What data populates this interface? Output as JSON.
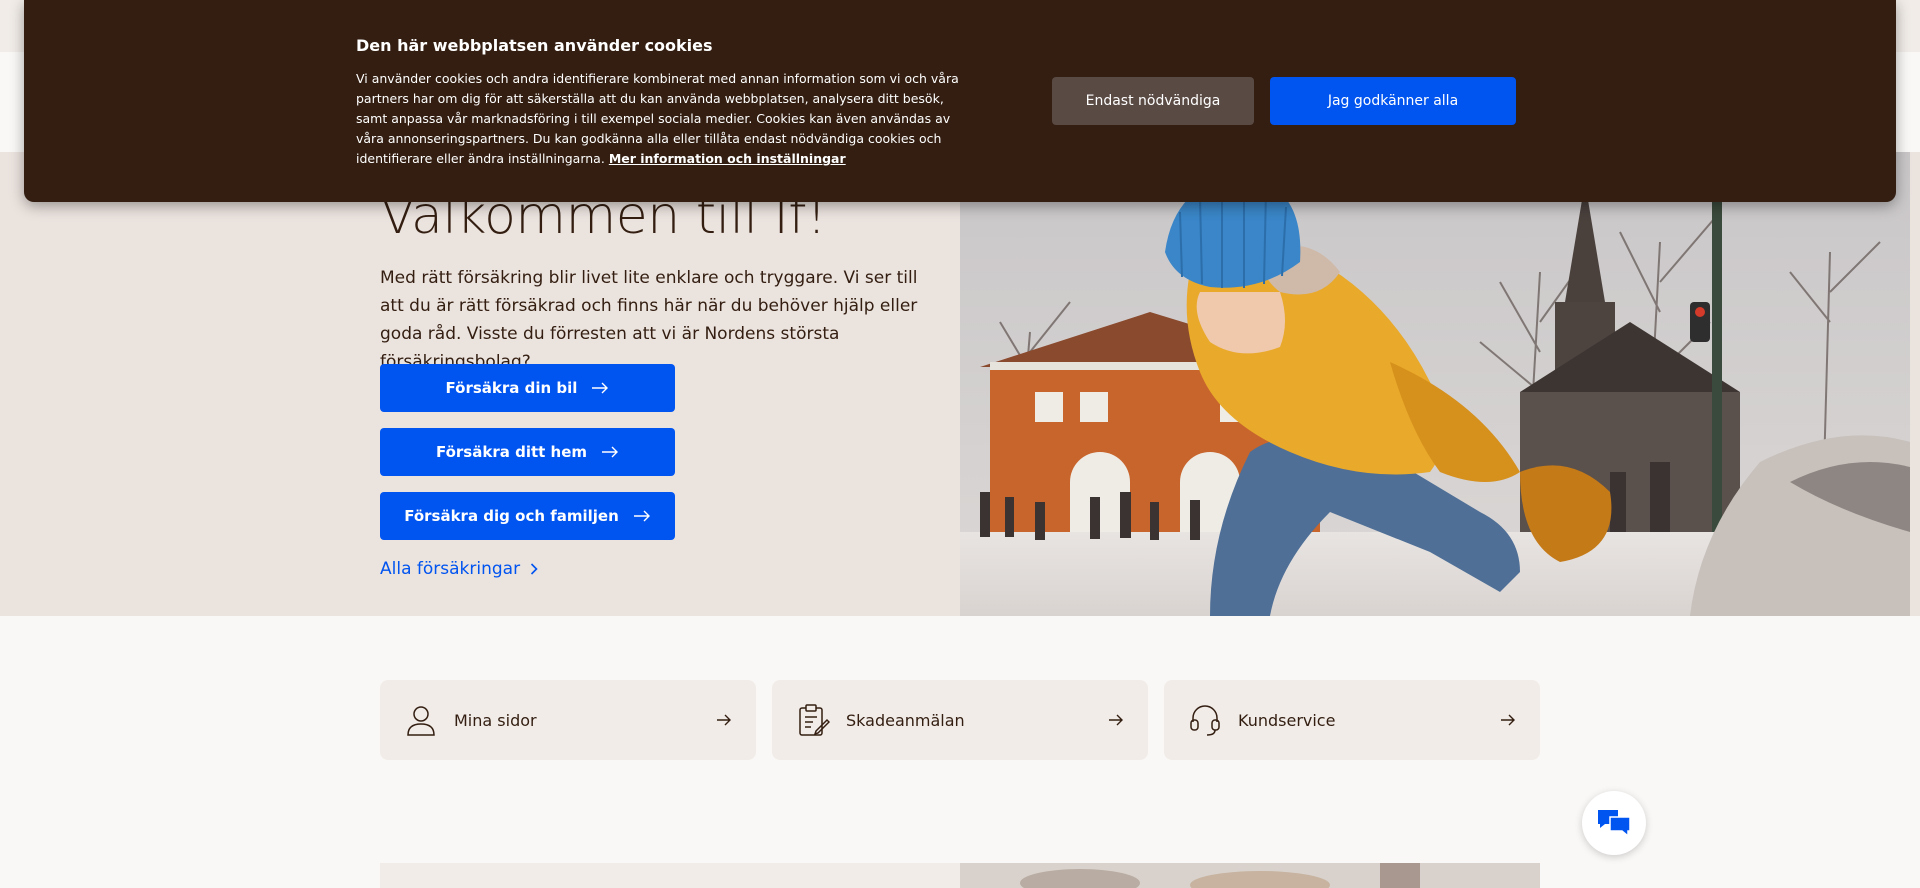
{
  "cookie_banner": {
    "title": "Den här webbplatsen använder cookies",
    "body": "Vi använder cookies och andra identifierare kombinerat med annan information som vi och våra partners har om dig för att säkerställa att du kan använda webbplatsen, analysera ditt besök, samt anpassa vår marknadsföring i till exempel sociala medier. Cookies kan även användas av våra annonseringspartners. Du kan godkänna alla eller tillåta endast nödvändiga cookies och identifierare eller ändra inställningarna.",
    "more_link": "Mer information och inställningar",
    "necessary_button": "Endast nödvändiga",
    "accept_button": "Jag godkänner alla"
  },
  "hero": {
    "title": "Välkommen till If!",
    "text": "Med rätt försäkring blir livet lite enklare och tryggare. Vi ser till att du är rätt försäkrad och finns här när du behöver hjälp eller goda råd. Visste du förresten att vi är Nordens största försäkringsbolag?",
    "buttons": [
      {
        "label": "Försäkra din bil",
        "icon": "arrow-right-icon"
      },
      {
        "label": "Försäkra ditt hem",
        "icon": "arrow-right-icon"
      },
      {
        "label": "Försäkra dig och familjen",
        "icon": "arrow-right-icon"
      }
    ],
    "all_link": "Alla försäkringar",
    "image": "woman-in-yellow-jacket-ice-skating-photo"
  },
  "shortcuts": [
    {
      "label": "Mina sidor",
      "icon": "user-icon"
    },
    {
      "label": "Skadeanmälan",
      "icon": "clipboard-edit-icon"
    },
    {
      "label": "Kundservice",
      "icon": "headset-icon"
    }
  ],
  "chat": {
    "icon": "chat-bubbles-icon"
  },
  "colors": {
    "brand_blue": "#0054f0",
    "dark_brown": "#331e11",
    "hero_bg": "#ebe3de",
    "card_bg": "#f1ece8"
  }
}
